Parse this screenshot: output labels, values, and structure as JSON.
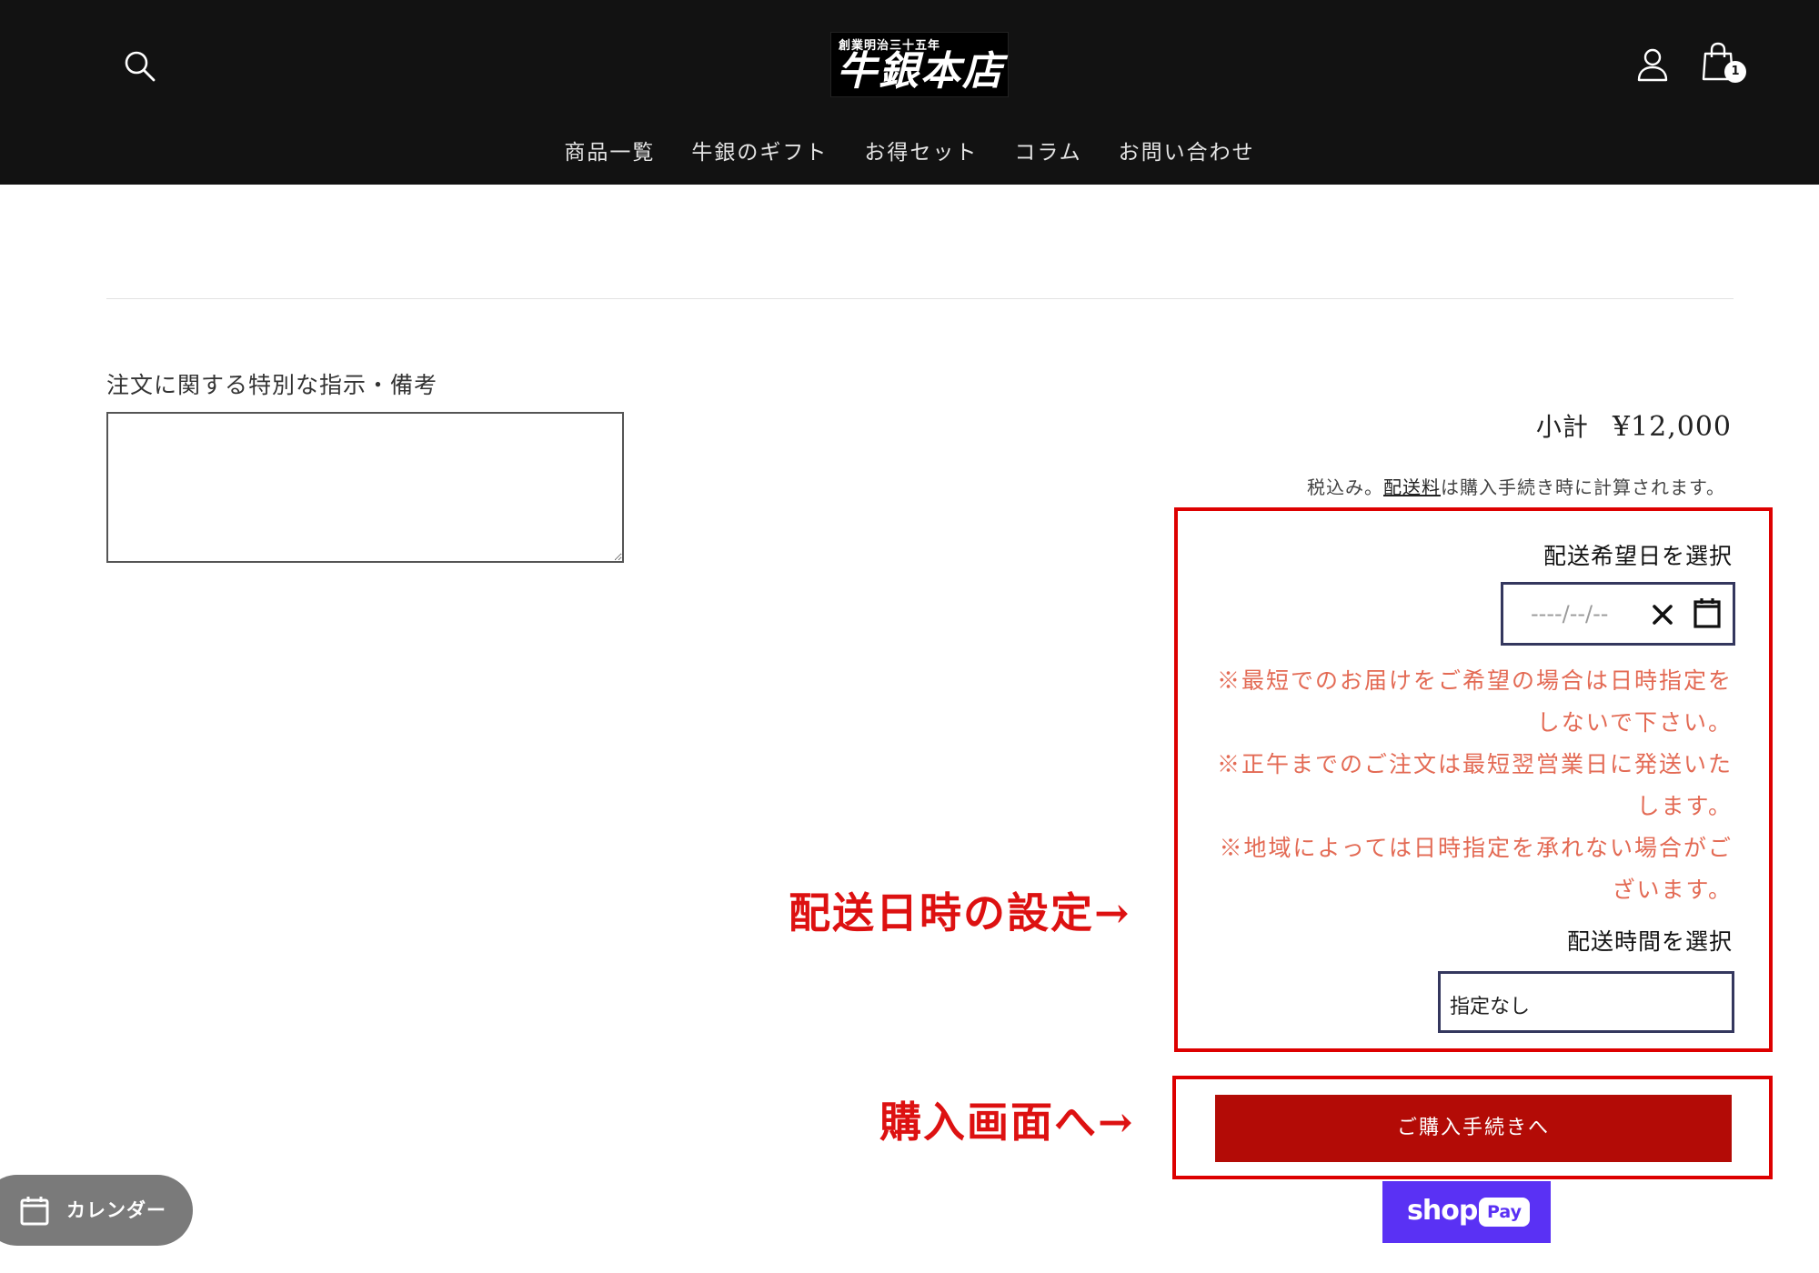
{
  "header": {
    "logo_subtitle": "創業明治三十五年",
    "logo_title": "牛銀本店",
    "cart_count": "1",
    "nav": [
      {
        "label": "商品一覧"
      },
      {
        "label": "牛銀のギフト"
      },
      {
        "label": "お得セット"
      },
      {
        "label": "コラム"
      },
      {
        "label": "お問い合わせ"
      }
    ]
  },
  "cart": {
    "note_label": "注文に関する特別な指示・備考",
    "note_value": "",
    "subtotal_label": "小計",
    "subtotal_amount": "¥12,000",
    "tax_prefix": "税込み。",
    "tax_link": "配送料",
    "tax_suffix": "は購入手続き時に計算されます。"
  },
  "delivery": {
    "date_label": "配送希望日を選択",
    "date_placeholder": "----/--/--",
    "notices": [
      "※最短でのお届けをご希望の場合は日時指定をしないで下さい。",
      "※正午までのご注文は最短翌営業日に発送いたします。",
      "※地域によっては日時指定を承れない場合がございます。"
    ],
    "time_label": "配送時間を選択",
    "time_value": "指定なし"
  },
  "annotations": {
    "delivery_setting": "配送日時の設定→",
    "to_checkout": "購入画面へ→"
  },
  "checkout": {
    "button_label": "ご購入手続きへ",
    "shop_pay_word": "shop",
    "shop_pay_pill": "Pay"
  },
  "calendar_fab": {
    "label": "カレンダー"
  },
  "colors": {
    "header_bg": "#121212",
    "annotation_red": "#dd0000",
    "checkout_button": "#b30b06",
    "notice_text": "#e36a54",
    "shop_pay": "#5a31f4",
    "input_border": "#34375e"
  }
}
